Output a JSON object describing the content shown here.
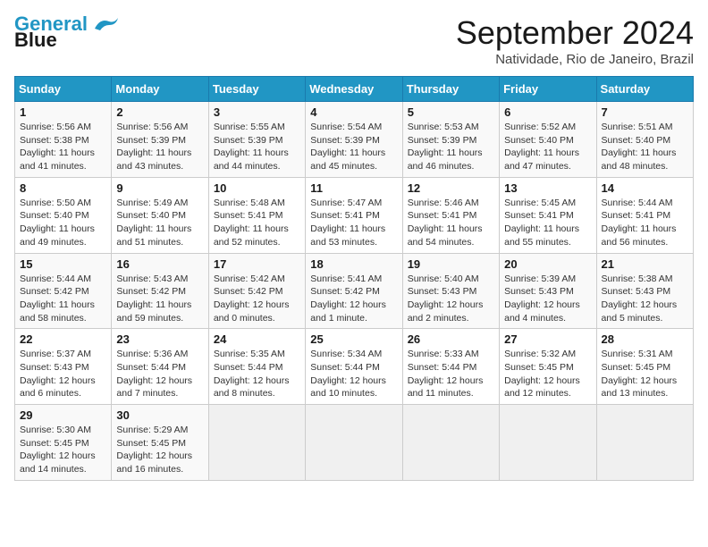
{
  "header": {
    "logo_line1": "General",
    "logo_line2": "Blue",
    "month": "September 2024",
    "location": "Natividade, Rio de Janeiro, Brazil"
  },
  "days_of_week": [
    "Sunday",
    "Monday",
    "Tuesday",
    "Wednesday",
    "Thursday",
    "Friday",
    "Saturday"
  ],
  "weeks": [
    [
      {
        "day": 1,
        "info": "Sunrise: 5:56 AM\nSunset: 5:38 PM\nDaylight: 11 hours\nand 41 minutes."
      },
      {
        "day": 2,
        "info": "Sunrise: 5:56 AM\nSunset: 5:39 PM\nDaylight: 11 hours\nand 43 minutes."
      },
      {
        "day": 3,
        "info": "Sunrise: 5:55 AM\nSunset: 5:39 PM\nDaylight: 11 hours\nand 44 minutes."
      },
      {
        "day": 4,
        "info": "Sunrise: 5:54 AM\nSunset: 5:39 PM\nDaylight: 11 hours\nand 45 minutes."
      },
      {
        "day": 5,
        "info": "Sunrise: 5:53 AM\nSunset: 5:39 PM\nDaylight: 11 hours\nand 46 minutes."
      },
      {
        "day": 6,
        "info": "Sunrise: 5:52 AM\nSunset: 5:40 PM\nDaylight: 11 hours\nand 47 minutes."
      },
      {
        "day": 7,
        "info": "Sunrise: 5:51 AM\nSunset: 5:40 PM\nDaylight: 11 hours\nand 48 minutes."
      }
    ],
    [
      {
        "day": 8,
        "info": "Sunrise: 5:50 AM\nSunset: 5:40 PM\nDaylight: 11 hours\nand 49 minutes."
      },
      {
        "day": 9,
        "info": "Sunrise: 5:49 AM\nSunset: 5:40 PM\nDaylight: 11 hours\nand 51 minutes."
      },
      {
        "day": 10,
        "info": "Sunrise: 5:48 AM\nSunset: 5:41 PM\nDaylight: 11 hours\nand 52 minutes."
      },
      {
        "day": 11,
        "info": "Sunrise: 5:47 AM\nSunset: 5:41 PM\nDaylight: 11 hours\nand 53 minutes."
      },
      {
        "day": 12,
        "info": "Sunrise: 5:46 AM\nSunset: 5:41 PM\nDaylight: 11 hours\nand 54 minutes."
      },
      {
        "day": 13,
        "info": "Sunrise: 5:45 AM\nSunset: 5:41 PM\nDaylight: 11 hours\nand 55 minutes."
      },
      {
        "day": 14,
        "info": "Sunrise: 5:44 AM\nSunset: 5:41 PM\nDaylight: 11 hours\nand 56 minutes."
      }
    ],
    [
      {
        "day": 15,
        "info": "Sunrise: 5:44 AM\nSunset: 5:42 PM\nDaylight: 11 hours\nand 58 minutes."
      },
      {
        "day": 16,
        "info": "Sunrise: 5:43 AM\nSunset: 5:42 PM\nDaylight: 11 hours\nand 59 minutes."
      },
      {
        "day": 17,
        "info": "Sunrise: 5:42 AM\nSunset: 5:42 PM\nDaylight: 12 hours\nand 0 minutes."
      },
      {
        "day": 18,
        "info": "Sunrise: 5:41 AM\nSunset: 5:42 PM\nDaylight: 12 hours\nand 1 minute."
      },
      {
        "day": 19,
        "info": "Sunrise: 5:40 AM\nSunset: 5:43 PM\nDaylight: 12 hours\nand 2 minutes."
      },
      {
        "day": 20,
        "info": "Sunrise: 5:39 AM\nSunset: 5:43 PM\nDaylight: 12 hours\nand 4 minutes."
      },
      {
        "day": 21,
        "info": "Sunrise: 5:38 AM\nSunset: 5:43 PM\nDaylight: 12 hours\nand 5 minutes."
      }
    ],
    [
      {
        "day": 22,
        "info": "Sunrise: 5:37 AM\nSunset: 5:43 PM\nDaylight: 12 hours\nand 6 minutes."
      },
      {
        "day": 23,
        "info": "Sunrise: 5:36 AM\nSunset: 5:44 PM\nDaylight: 12 hours\nand 7 minutes."
      },
      {
        "day": 24,
        "info": "Sunrise: 5:35 AM\nSunset: 5:44 PM\nDaylight: 12 hours\nand 8 minutes."
      },
      {
        "day": 25,
        "info": "Sunrise: 5:34 AM\nSunset: 5:44 PM\nDaylight: 12 hours\nand 10 minutes."
      },
      {
        "day": 26,
        "info": "Sunrise: 5:33 AM\nSunset: 5:44 PM\nDaylight: 12 hours\nand 11 minutes."
      },
      {
        "day": 27,
        "info": "Sunrise: 5:32 AM\nSunset: 5:45 PM\nDaylight: 12 hours\nand 12 minutes."
      },
      {
        "day": 28,
        "info": "Sunrise: 5:31 AM\nSunset: 5:45 PM\nDaylight: 12 hours\nand 13 minutes."
      }
    ],
    [
      {
        "day": 29,
        "info": "Sunrise: 5:30 AM\nSunset: 5:45 PM\nDaylight: 12 hours\nand 14 minutes."
      },
      {
        "day": 30,
        "info": "Sunrise: 5:29 AM\nSunset: 5:45 PM\nDaylight: 12 hours\nand 16 minutes."
      },
      null,
      null,
      null,
      null,
      null
    ]
  ]
}
